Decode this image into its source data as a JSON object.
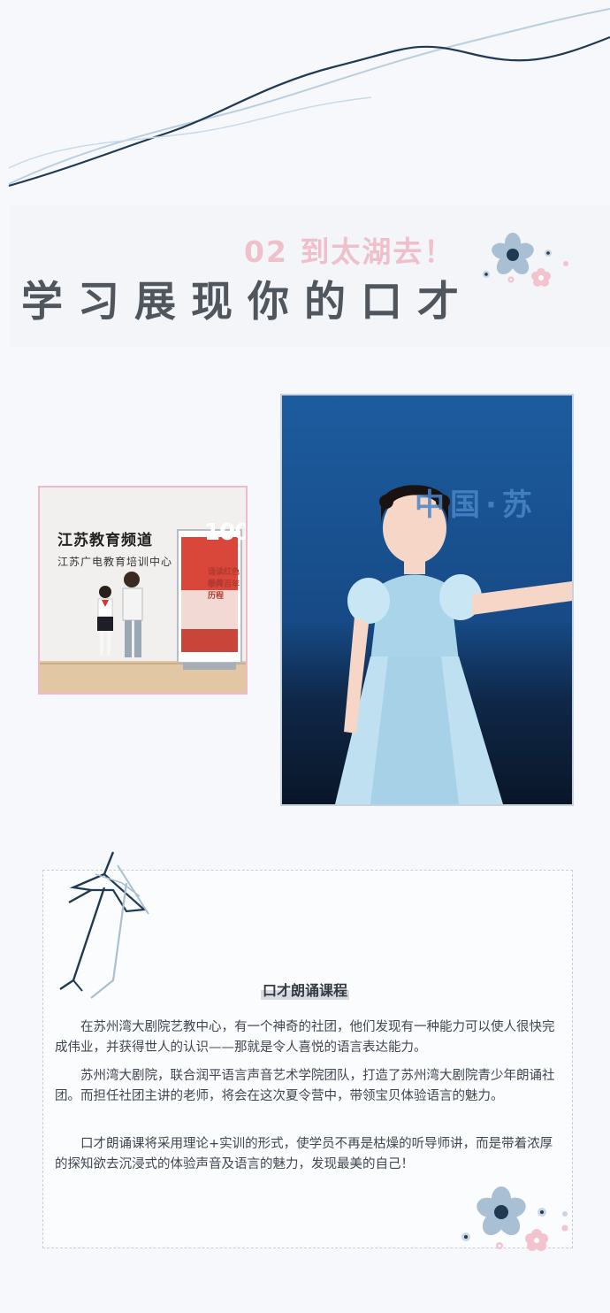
{
  "header": {
    "subtitle": "02 到太湖去！",
    "title": "学习展现你的口才"
  },
  "photos": {
    "left": {
      "sign_main": "江苏教育频道",
      "sign_sub": "江苏广电教育培训中心",
      "poster_number": "100",
      "poster_line1": "诵读红色经典",
      "poster_line2": "学传百年历程"
    },
    "right": {
      "backdrop_text": "中国·苏"
    }
  },
  "course": {
    "heading": "口才朗诵课程",
    "paragraphs": [
      "在苏州湾大剧院艺教中心，有一个神奇的社团，他们发现有一种能力可以使人很快完成伟业，并获得世人的认识——那就是令人喜悦的语言表达能力。",
      "苏州湾大剧院，联合润平语言声音艺术学院团队，打造了苏州湾大剧院青少年朗诵社团。而担任社团主讲的老师，将会在这次夏令营中，带领宝贝体验语言的魅力。",
      "口才朗诵课将采用理论+实训的形式，使学员不再是枯燥的听导师讲，而是带着浓厚的探知欲去沉浸式的体验声音及语言的魅力，发现最美的自己！"
    ]
  },
  "colors": {
    "accent_pink": "#efc0cb",
    "title_gray": "#4f565e",
    "navy": "#1f3a52",
    "light_blue": "#a9bfd3"
  },
  "icons": [
    "flower-icon",
    "umbrella-icon",
    "wave-decoration"
  ]
}
